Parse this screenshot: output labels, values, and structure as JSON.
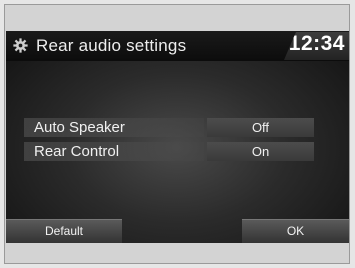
{
  "header": {
    "title": "Rear audio settings",
    "clock": "12:34",
    "icon": "gear-icon"
  },
  "settings": [
    {
      "label": "Auto Speaker",
      "value": "Off"
    },
    {
      "label": "Rear Control",
      "value": "On"
    }
  ],
  "buttons": {
    "default_label": "Default",
    "ok_label": "OK"
  }
}
